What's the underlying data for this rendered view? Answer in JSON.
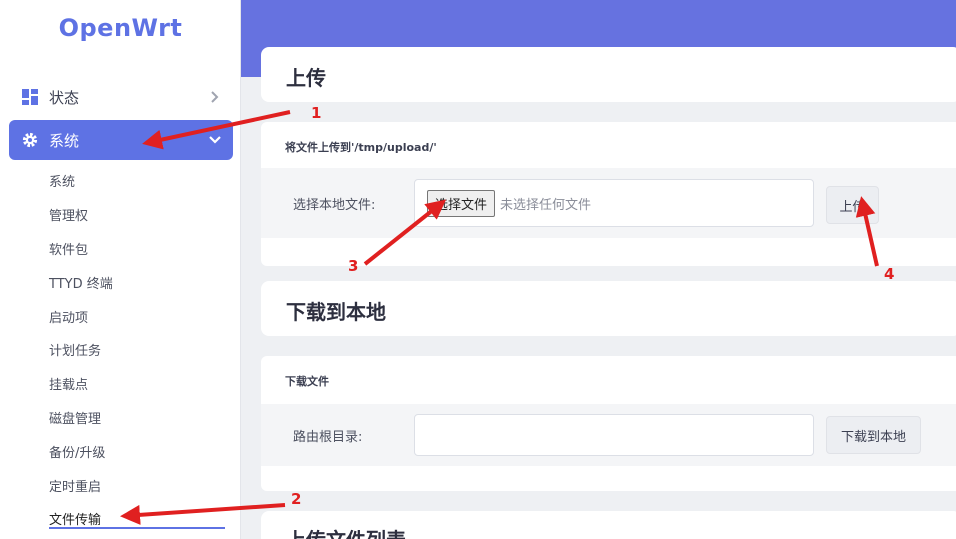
{
  "brand": {
    "logo": "OpenWrt",
    "accent": "#5e72e4"
  },
  "sidebar": {
    "items": [
      {
        "label": "状态",
        "icon": "dashboard-icon"
      },
      {
        "label": "系统",
        "icon": "gear-icon"
      }
    ],
    "submenu": [
      "系统",
      "管理权",
      "软件包",
      "TTYD 终端",
      "启动项",
      "计划任务",
      "挂载点",
      "磁盘管理",
      "备份/升级",
      "定时重启",
      "文件传输"
    ],
    "active_sub": "文件传输"
  },
  "upload": {
    "title": "上传",
    "section_label": "将文件上传到'/tmp/upload/'",
    "row_label": "选择本地文件:",
    "choose_button": "选择文件",
    "no_file_text": "未选择任何文件",
    "upload_button": "上传"
  },
  "download": {
    "title": "下载到本地",
    "section_label": "下载文件",
    "row_label": "路由根目录:",
    "input_value": "",
    "download_button": "下载到本地"
  },
  "upload_list": {
    "title": "上传文件列表"
  },
  "annotations": {
    "numbers": [
      "1",
      "2",
      "3",
      "4"
    ],
    "color": "#e02020"
  }
}
